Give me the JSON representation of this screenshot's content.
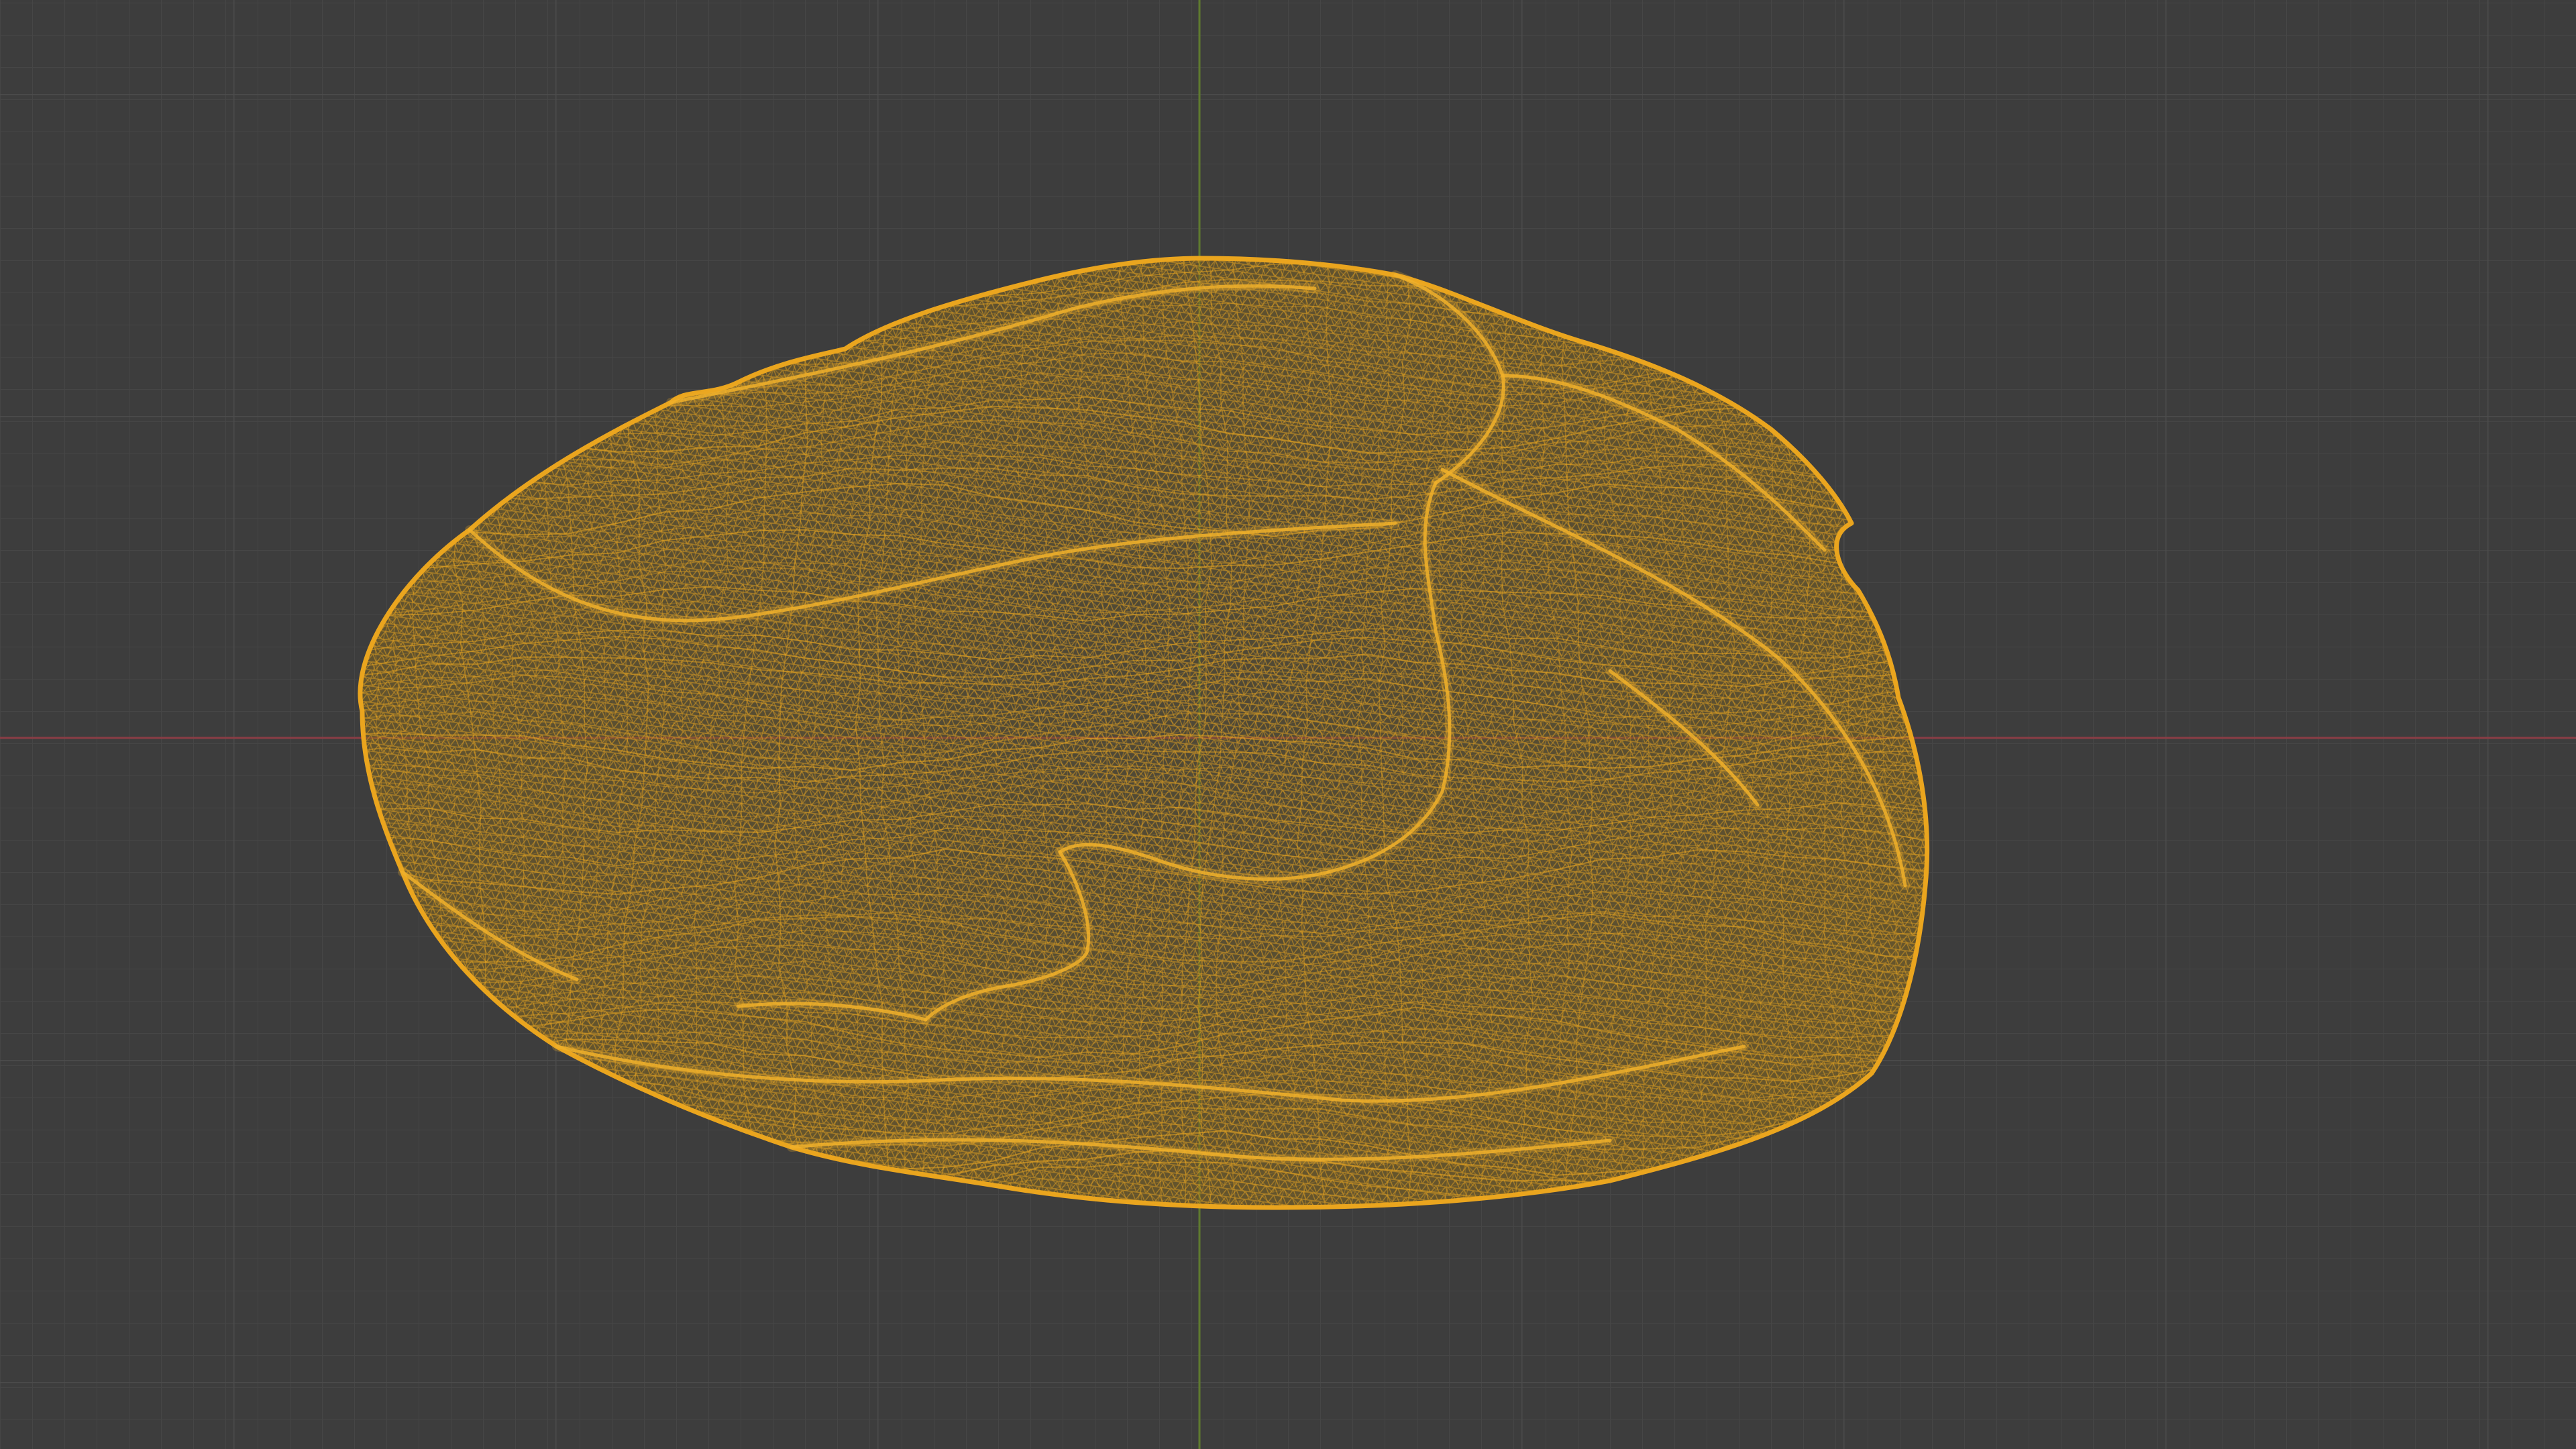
{
  "viewport": {
    "editor": "3D Viewport",
    "shading_mode": "wireframe",
    "object_selected": true,
    "grid_visible": true,
    "colors": {
      "background": "#3d3d3d",
      "grid_minor": "#464646",
      "grid_major": "#4e4e4e",
      "x_axis": "#8a3d45",
      "y_axis": "#5f7a2f",
      "wireframe_selected": "#e8a21c",
      "wireframe_shadow": "#8a6a1c"
    }
  }
}
